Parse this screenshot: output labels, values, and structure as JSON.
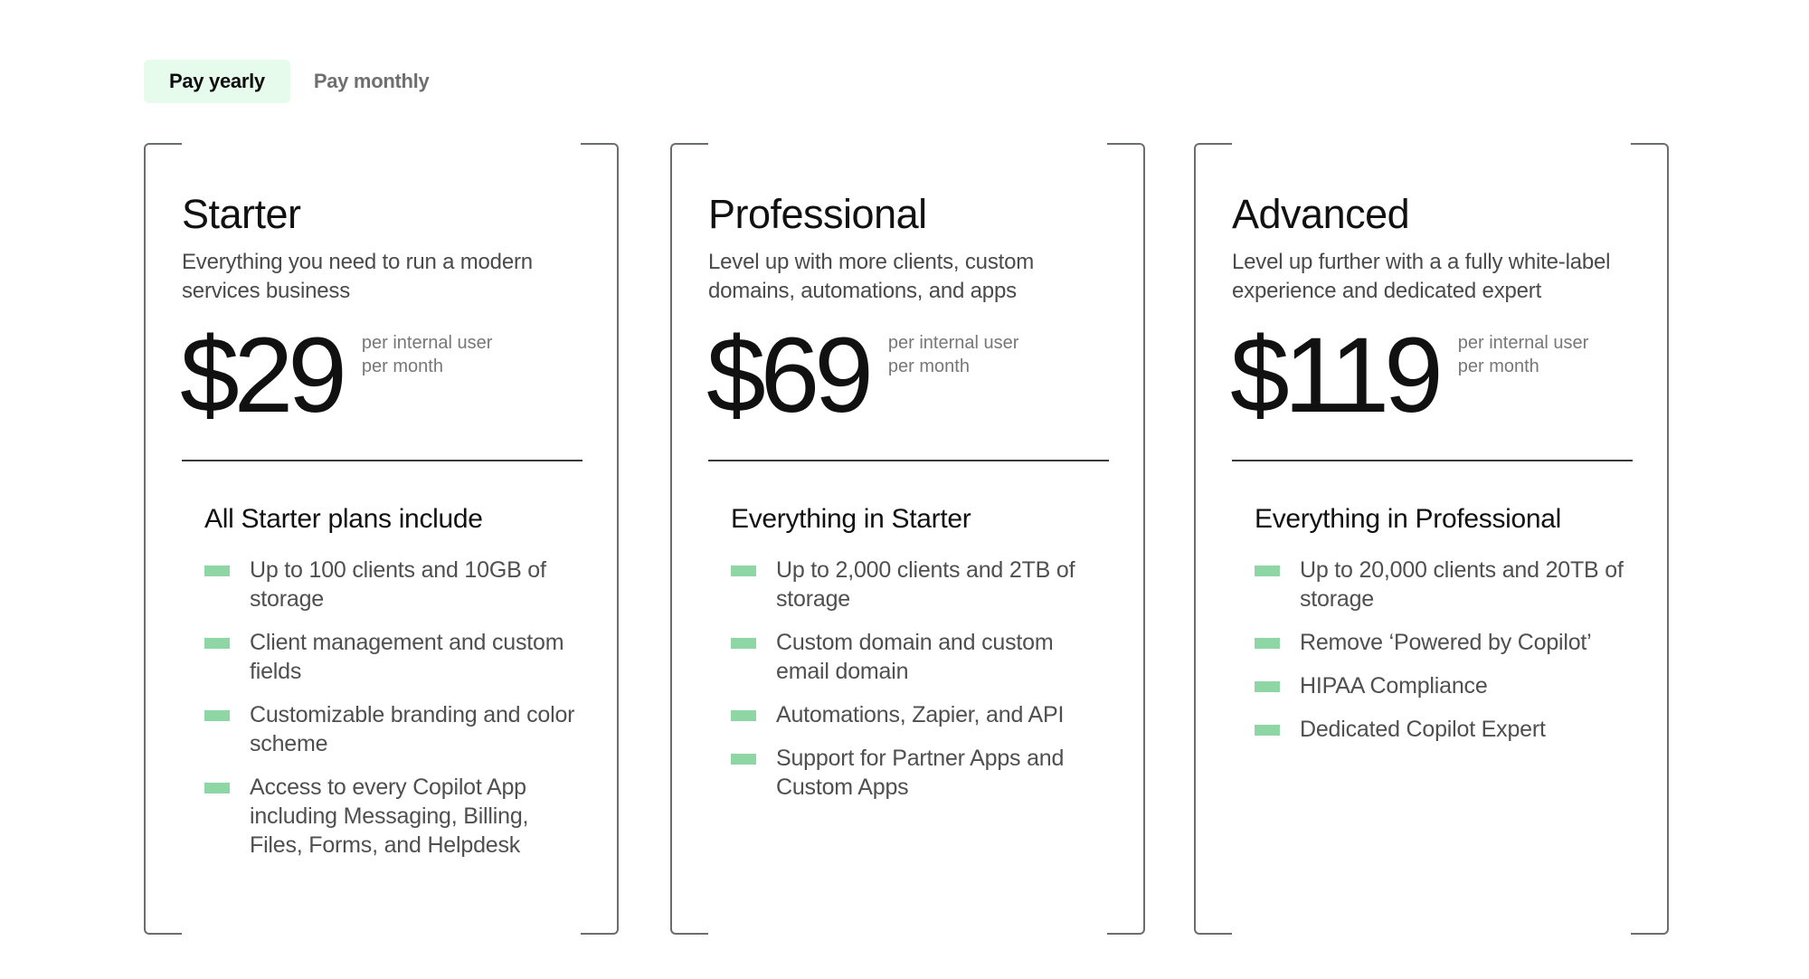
{
  "billing_toggle": {
    "options": [
      {
        "label": "Pay yearly",
        "selected": true
      },
      {
        "label": "Pay monthly",
        "selected": false
      }
    ]
  },
  "colors": {
    "accent_green": "#8fd6a5",
    "toggle_active_bg": "#e6fbec",
    "border": "#6a6e71"
  },
  "plans": [
    {
      "name": "Starter",
      "description": "Everything you need to run a modern services business",
      "price": "$29",
      "price_unit_line1": "per internal user",
      "price_unit_line2": "per month",
      "features_heading": "All Starter plans include",
      "features": [
        "Up to 100 clients and 10GB of storage",
        "Client management and custom fields",
        "Customizable branding and color scheme",
        "Access to every Copilot App including Messaging, Billing, Files, Forms, and Helpdesk"
      ]
    },
    {
      "name": "Professional",
      "description": "Level up with more clients, custom domains, automations, and apps",
      "price": "$69",
      "price_unit_line1": "per internal user",
      "price_unit_line2": "per month",
      "features_heading": "Everything in Starter",
      "features": [
        "Up to 2,000 clients and 2TB of storage",
        "Custom domain and custom email domain",
        "Automations, Zapier, and API",
        "Support for Partner Apps and Custom Apps"
      ]
    },
    {
      "name": "Advanced",
      "description": "Level up further with a a fully white-label experience and dedicated expert",
      "price": "$119",
      "price_unit_line1": "per internal user",
      "price_unit_line2": "per month",
      "features_heading": "Everything in Professional",
      "features": [
        "Up to 20,000 clients and 20TB of storage",
        "Remove ‘Powered by Copilot’",
        "HIPAA Compliance",
        "Dedicated Copilot Expert"
      ]
    }
  ]
}
